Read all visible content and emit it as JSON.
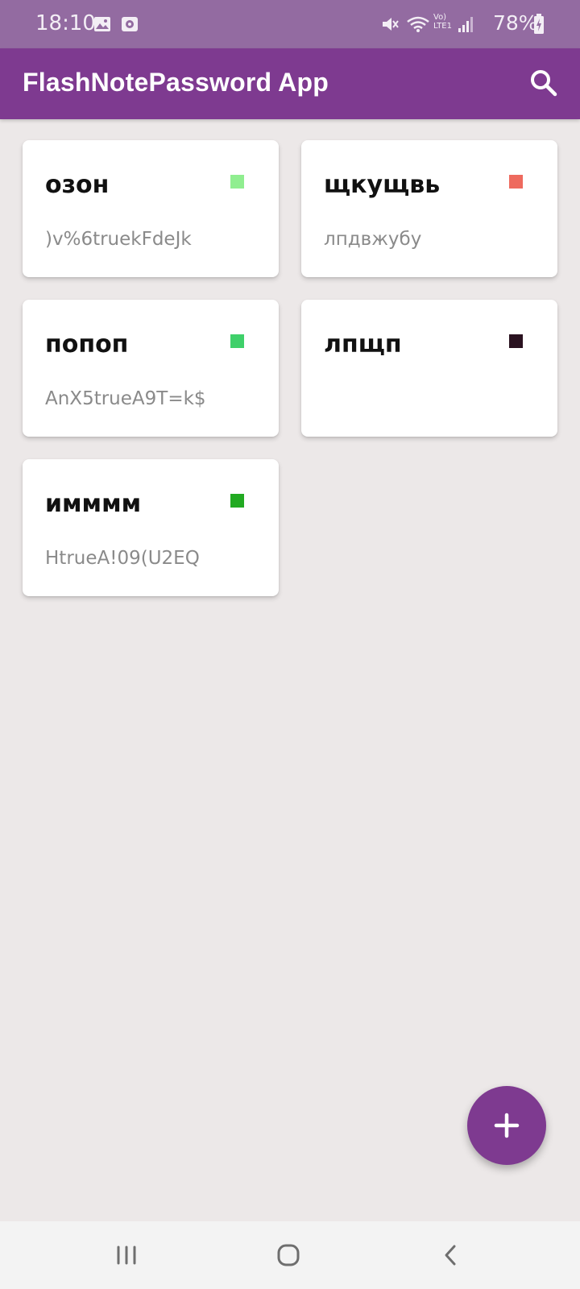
{
  "status_bar": {
    "time": "18:10",
    "battery": "78%",
    "lte_label": "Vo) LTE1",
    "icons": [
      "image-icon",
      "media-icon",
      "mute-icon",
      "wifi-icon",
      "lte-icon",
      "signal-icon",
      "battery-icon"
    ]
  },
  "app_bar": {
    "title": "FlashNotePassword App",
    "search_icon": "search-icon",
    "color": "#7e3a90"
  },
  "cards": [
    {
      "title": "озон",
      "password": ")v%6truekFdeJk",
      "color": "#90ee90"
    },
    {
      "title": "щкущвь",
      "password": "лпдвжубу",
      "color": "#ee6a5e"
    },
    {
      "title": "попоп",
      "password": "AnX5trueA9T=k$",
      "color": "#3fd06a"
    },
    {
      "title": "лпщп",
      "password": "",
      "color": "#2a1220"
    },
    {
      "title": "имммм",
      "password": "HtrueA!09(U2EQ",
      "color": "#22aa22"
    }
  ],
  "fab": {
    "icon": "plus-icon",
    "color": "#7e3a90"
  },
  "nav_bar": {
    "recent_icon": "recent-apps-icon",
    "home_icon": "home-icon",
    "back_icon": "back-icon"
  }
}
